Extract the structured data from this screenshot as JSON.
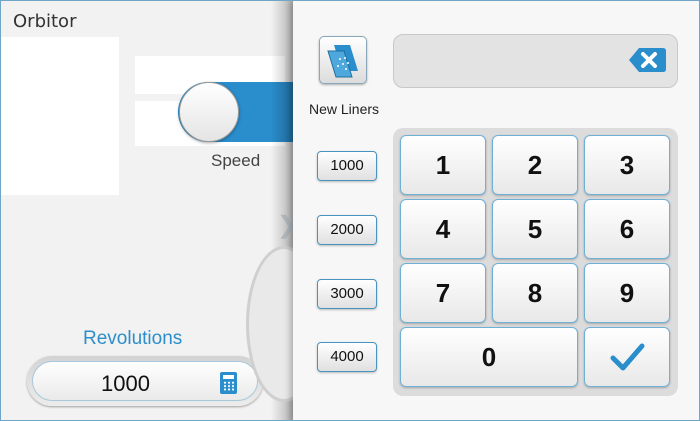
{
  "app": {
    "title": "Orbitor"
  },
  "left": {
    "toggle_label": "Speed",
    "revolutions_label": "Revolutions",
    "revolutions_value": "1000",
    "icons": {
      "toggle": "toggle-switch",
      "calculator": "calculator-icon"
    }
  },
  "right": {
    "new_liners_label": "New Liners",
    "display_value": "",
    "presets": [
      "1000",
      "2000",
      "3000",
      "4000"
    ],
    "keys": [
      "1",
      "2",
      "3",
      "4",
      "5",
      "6",
      "7",
      "8",
      "9",
      "0"
    ],
    "icons": {
      "liners": "liners-icon",
      "backspace": "backspace-icon",
      "confirm": "checkmark-icon",
      "expand": "chevron-right-icon"
    }
  },
  "colors": {
    "accent": "#2a8dcc",
    "key_border": "#6fb0d6"
  }
}
